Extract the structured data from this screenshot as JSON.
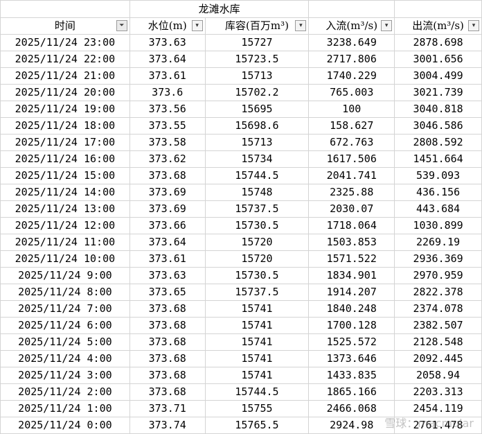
{
  "sheet": {
    "title": "龙滩水库",
    "headers": [
      {
        "label": "时间",
        "filter": "active"
      },
      {
        "label": "水位(m)",
        "filter": "dropdown"
      },
      {
        "label": "库容(百万m³)",
        "filter": "dropdown"
      },
      {
        "label": "入流(m³/s)",
        "filter": "dropdown"
      },
      {
        "label": "出流(m³/s)",
        "filter": "dropdown"
      }
    ],
    "rows": [
      [
        "2025/11/24 23:00",
        "373.63",
        "15727",
        "3238.649",
        "2878.698"
      ],
      [
        "2025/11/24 22:00",
        "373.64",
        "15723.5",
        "2717.806",
        "3001.656"
      ],
      [
        "2025/11/24 21:00",
        "373.61",
        "15713",
        "1740.229",
        "3004.499"
      ],
      [
        "2025/11/24 20:00",
        "373.6",
        "15702.2",
        "765.003",
        "3021.739"
      ],
      [
        "2025/11/24 19:00",
        "373.56",
        "15695",
        "100",
        "3040.818"
      ],
      [
        "2025/11/24 18:00",
        "373.55",
        "15698.6",
        "158.627",
        "3046.586"
      ],
      [
        "2025/11/24 17:00",
        "373.58",
        "15713",
        "672.763",
        "2808.592"
      ],
      [
        "2025/11/24 16:00",
        "373.62",
        "15734",
        "1617.506",
        "1451.664"
      ],
      [
        "2025/11/24 15:00",
        "373.68",
        "15744.5",
        "2041.741",
        "539.093"
      ],
      [
        "2025/11/24 14:00",
        "373.69",
        "15748",
        "2325.88",
        "436.156"
      ],
      [
        "2025/11/24 13:00",
        "373.69",
        "15737.5",
        "2030.07",
        "443.684"
      ],
      [
        "2025/11/24 12:00",
        "373.66",
        "15730.5",
        "1718.064",
        "1030.899"
      ],
      [
        "2025/11/24 11:00",
        "373.64",
        "15720",
        "1503.853",
        "2269.19"
      ],
      [
        "2025/11/24 10:00",
        "373.61",
        "15720",
        "1571.522",
        "2936.369"
      ],
      [
        "2025/11/24 9:00",
        "373.63",
        "15730.5",
        "1834.901",
        "2970.959"
      ],
      [
        "2025/11/24 8:00",
        "373.65",
        "15737.5",
        "1914.207",
        "2822.378"
      ],
      [
        "2025/11/24 7:00",
        "373.68",
        "15741",
        "1840.248",
        "2374.078"
      ],
      [
        "2025/11/24 6:00",
        "373.68",
        "15741",
        "1700.128",
        "2382.507"
      ],
      [
        "2025/11/24 5:00",
        "373.68",
        "15741",
        "1525.572",
        "2128.548"
      ],
      [
        "2025/11/24 4:00",
        "373.68",
        "15741",
        "1373.646",
        "2092.445"
      ],
      [
        "2025/11/24 3:00",
        "373.68",
        "15741",
        "1433.835",
        "2058.94"
      ],
      [
        "2025/11/24 2:00",
        "373.68",
        "15744.5",
        "1865.166",
        "2203.313"
      ],
      [
        "2025/11/24 1:00",
        "373.71",
        "15755",
        "2466.068",
        "2454.119"
      ],
      [
        "2025/11/24 0:00",
        "373.74",
        "15765.5",
        "2924.98",
        "2761.478"
      ]
    ]
  },
  "watermark": "雪球：macmular"
}
